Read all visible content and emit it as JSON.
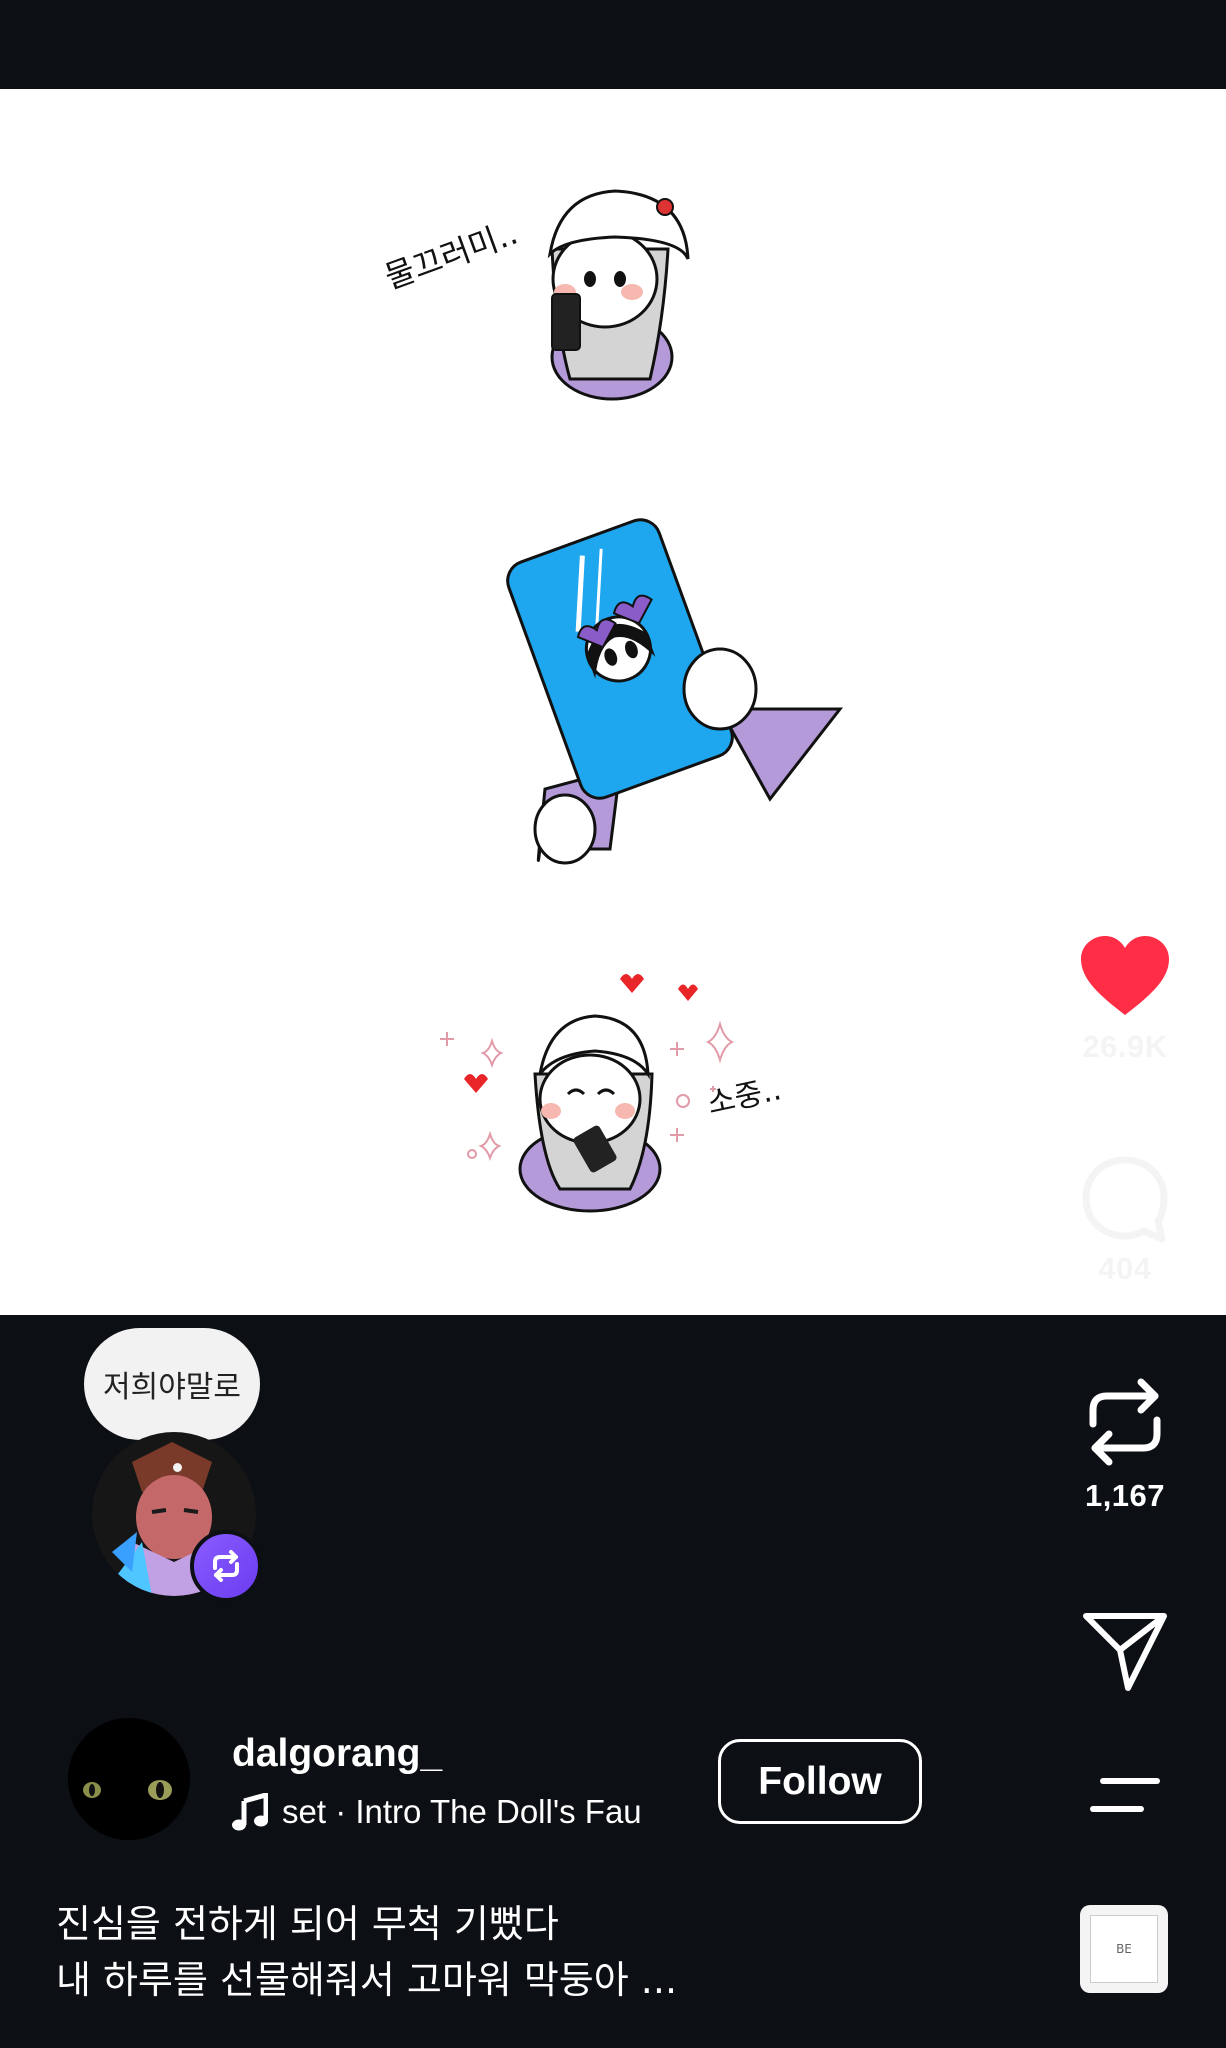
{
  "post": {
    "like_count": "26.9K",
    "comment_count": "404",
    "repost_count": "1,167",
    "note_text": "저희야말로",
    "author": {
      "username": "dalgorang_",
      "follow_label": "Follow",
      "music": "set · Intro      The Doll's Fau"
    },
    "caption_lines": [
      "진심을 전하게 되어 무척 기뻤다",
      "내 하루를 선물해줘서 고마워 막둥아 ..."
    ],
    "album_art_text": "BE"
  },
  "illustration": {
    "top_text": "물끄러미..",
    "bottom_text": "소중.."
  },
  "colors": {
    "background": "#0c0f14",
    "like_red": "#ff2d46",
    "repost_badge": "#7c4dff"
  },
  "icons": [
    "heart-icon",
    "comment-icon",
    "repost-icon",
    "send-icon",
    "menu-icon",
    "music-note-icon",
    "repost-badge-icon"
  ]
}
